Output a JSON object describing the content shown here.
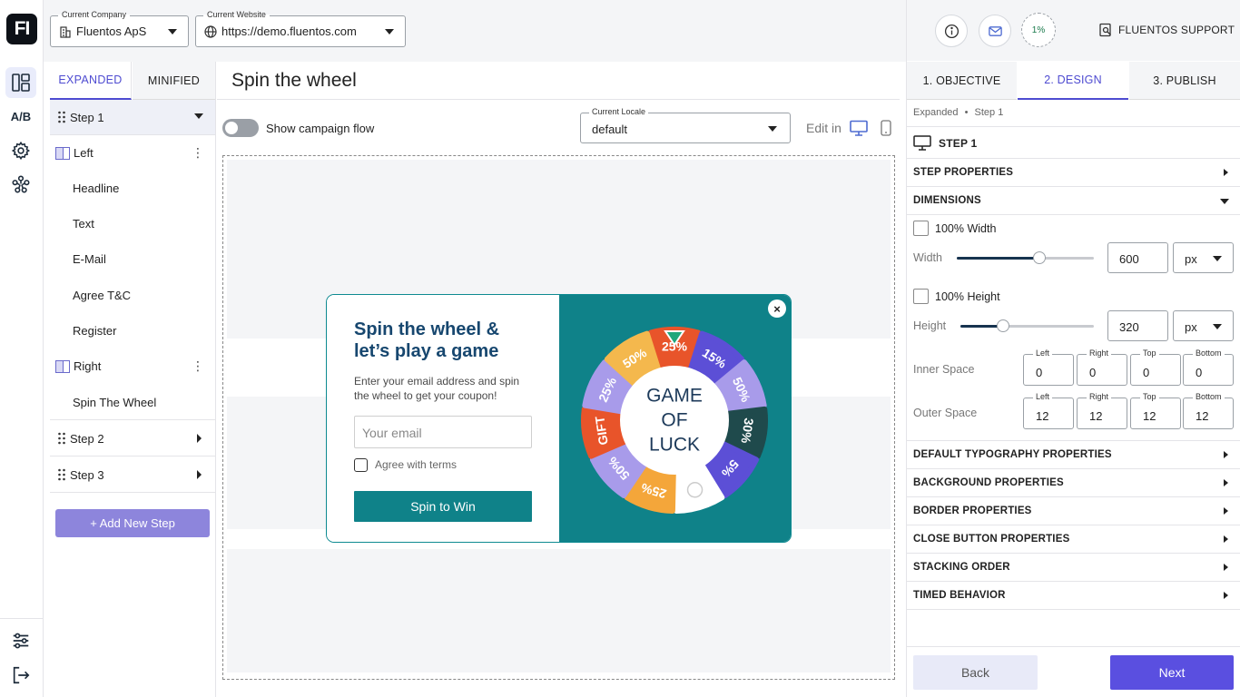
{
  "app": {
    "logo_text": "FI",
    "brand_color": "#4e4bd1"
  },
  "rail": {
    "ab_label": "A/B",
    "icons": [
      "layers-icon",
      "ab-test-icon",
      "gear-icon",
      "integrations-icon",
      "sliders-icon",
      "logout-icon"
    ]
  },
  "header": {
    "company_label": "Current Company",
    "company_value": "Fluentos ApS",
    "website_label": "Current Website",
    "website_value": "https://demo.fluentos.com"
  },
  "steps_panel": {
    "tabs": [
      "EXPANDED",
      "MINIFIED"
    ],
    "active_tab": "EXPANDED",
    "tree": {
      "step1": "Step 1",
      "left_column": "Left",
      "left_items": [
        "Headline",
        "Text",
        "E-Mail",
        "Agree T&C",
        "Register"
      ],
      "right_column": "Right",
      "right_items": [
        "Spin The Wheel"
      ],
      "step2": "Step 2",
      "step3": "Step 3"
    },
    "add_step": "+ Add New Step"
  },
  "editor": {
    "title": "Spin the wheel",
    "show_flow_label": "Show campaign flow",
    "show_flow_on": false,
    "locale_label": "Current Locale",
    "locale_value": "default",
    "edit_in_label": "Edit in"
  },
  "popup": {
    "headline": "Spin the wheel & let’s play a game",
    "text": "Enter your email address and spin the wheel to get your coupon!",
    "email_placeholder": "Your email",
    "agree_label": "Agree with terms",
    "button_label": "Spin to Win",
    "close_symbol": "×",
    "accent_color": "#0f8289",
    "wheel": {
      "center_lines": [
        "GAME",
        "OF",
        "LUCK"
      ],
      "segments": [
        "25%",
        "15%",
        "50%",
        "30%",
        "5%",
        "",
        "25%",
        "50%",
        "GIFT",
        "25%",
        "50%"
      ]
    }
  },
  "right_panel": {
    "progress": "1%",
    "support_label": "FLUENTOS SUPPORT",
    "tabs": [
      "1. OBJECTIVE",
      "2. DESIGN",
      "3. PUBLISH"
    ],
    "active_tab": "2. DESIGN",
    "breadcrumb": [
      "Expanded",
      "Step 1"
    ],
    "breadcrumb_sep": "•",
    "step_heading": "STEP 1",
    "step_properties": "STEP PROPERTIES",
    "dimensions": {
      "title": "DIMENSIONS",
      "full_width_label": "100% Width",
      "width_label": "Width",
      "width_value": "600",
      "width_unit": "px",
      "width_slider_fraction": 0.6,
      "full_height_label": "100% Height",
      "height_label": "Height",
      "height_value": "320",
      "height_unit": "px",
      "height_slider_fraction": 0.32,
      "inner_space_label": "Inner Space",
      "outer_space_label": "Outer Space",
      "space_fields": [
        "Left",
        "Right",
        "Top",
        "Bottom"
      ],
      "inner_space": [
        "0",
        "0",
        "0",
        "0"
      ],
      "outer_space": [
        "12",
        "12",
        "12",
        "12"
      ]
    },
    "sections": [
      "DEFAULT TYPOGRAPHY PROPERTIES",
      "BACKGROUND PROPERTIES",
      "BORDER PROPERTIES",
      "CLOSE BUTTON PROPERTIES",
      "STACKING ORDER",
      "TIMED BEHAVIOR"
    ],
    "back_label": "Back",
    "next_label": "Next"
  }
}
